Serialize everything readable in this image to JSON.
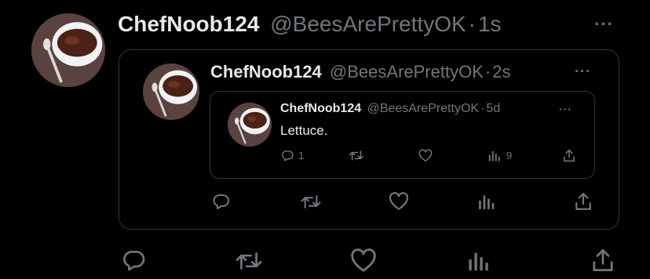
{
  "outer_tweet": {
    "name": "ChefNoob124",
    "handle": "@BeesArePrettyOK",
    "time": "1s",
    "more": "···",
    "actions": {
      "reply_icon": "reply-icon",
      "retweet_icon": "retweet-icon",
      "like_icon": "heart-icon",
      "views_icon": "views-icon",
      "share_icon": "share-icon"
    }
  },
  "quote1": {
    "name": "ChefNoob124",
    "handle": "@BeesArePrettyOK",
    "time": "2s",
    "more": "···"
  },
  "quote2": {
    "name": "ChefNoob124",
    "handle": "@BeesArePrettyOK",
    "time": "5d",
    "more": "···",
    "text": "Lettuce.",
    "reply_count": "1",
    "view_count": "9"
  },
  "separator": "·",
  "colors": {
    "background": "#000000",
    "text": "#e7e9ea",
    "muted": "#71767b",
    "border": "#333639"
  }
}
